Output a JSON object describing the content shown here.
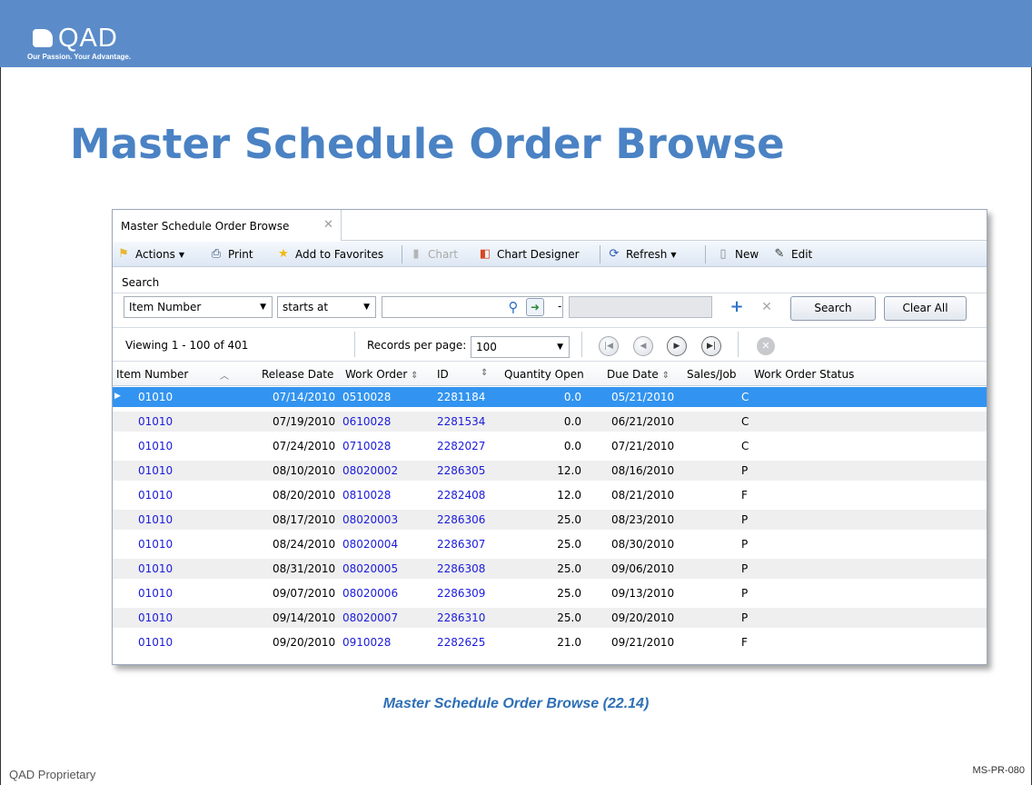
{
  "brand": {
    "name": "QAD",
    "tagline": "Our Passion. Your Advantage.",
    "header_color": "#5b8cc9"
  },
  "slide": {
    "title": "Master Schedule Order Browse",
    "caption": "Master Schedule Order Browse (22.14)",
    "footer_left": "QAD Proprietary",
    "footer_right": "MS-PR-080"
  },
  "tab": {
    "label": "Master Schedule Order Browse",
    "close_glyph": "✕"
  },
  "toolbar": {
    "actions": "Actions",
    "print": "Print",
    "add_favorites": "Add to Favorites",
    "chart": "Chart",
    "chart_designer": "Chart Designer",
    "refresh": "Refresh",
    "new": "New",
    "edit": "Edit"
  },
  "search": {
    "label": "Search",
    "field": "Item Number",
    "operator": "starts at",
    "value": "",
    "range_separator": "-",
    "search_button": "Search",
    "clear_button": "Clear All"
  },
  "pager": {
    "viewing": "Viewing 1 - 100  of  401",
    "records_label": "Records per page:",
    "records_value": "100"
  },
  "grid": {
    "columns": [
      "Item Number",
      "Release Date",
      "Work Order",
      "ID",
      "Quantity Open",
      "Due Date",
      "Sales/Job",
      "Work Order Status"
    ],
    "rows": [
      {
        "item": "01010",
        "release": "07/14/2010",
        "wo": "0510028",
        "id": "2281184",
        "qty": "0.0",
        "due": "05/21/2010",
        "salesjob": "",
        "status": "C"
      },
      {
        "item": "01010",
        "release": "07/19/2010",
        "wo": "0610028",
        "id": "2281534",
        "qty": "0.0",
        "due": "06/21/2010",
        "salesjob": "",
        "status": "C"
      },
      {
        "item": "01010",
        "release": "07/24/2010",
        "wo": "0710028",
        "id": "2282027",
        "qty": "0.0",
        "due": "07/21/2010",
        "salesjob": "",
        "status": "C"
      },
      {
        "item": "01010",
        "release": "08/10/2010",
        "wo": "08020002",
        "id": "2286305",
        "qty": "12.0",
        "due": "08/16/2010",
        "salesjob": "",
        "status": "P"
      },
      {
        "item": "01010",
        "release": "08/20/2010",
        "wo": "0810028",
        "id": "2282408",
        "qty": "12.0",
        "due": "08/21/2010",
        "salesjob": "",
        "status": "F"
      },
      {
        "item": "01010",
        "release": "08/17/2010",
        "wo": "08020003",
        "id": "2286306",
        "qty": "25.0",
        "due": "08/23/2010",
        "salesjob": "",
        "status": "P"
      },
      {
        "item": "01010",
        "release": "08/24/2010",
        "wo": "08020004",
        "id": "2286307",
        "qty": "25.0",
        "due": "08/30/2010",
        "salesjob": "",
        "status": "P"
      },
      {
        "item": "01010",
        "release": "08/31/2010",
        "wo": "08020005",
        "id": "2286308",
        "qty": "25.0",
        "due": "09/06/2010",
        "salesjob": "",
        "status": "P"
      },
      {
        "item": "01010",
        "release": "09/07/2010",
        "wo": "08020006",
        "id": "2286309",
        "qty": "25.0",
        "due": "09/13/2010",
        "salesjob": "",
        "status": "P"
      },
      {
        "item": "01010",
        "release": "09/14/2010",
        "wo": "08020007",
        "id": "2286310",
        "qty": "25.0",
        "due": "09/20/2010",
        "salesjob": "",
        "status": "P"
      },
      {
        "item": "01010",
        "release": "09/20/2010",
        "wo": "0910028",
        "id": "2282625",
        "qty": "21.0",
        "due": "09/21/2010",
        "salesjob": "",
        "status": "F"
      }
    ]
  }
}
